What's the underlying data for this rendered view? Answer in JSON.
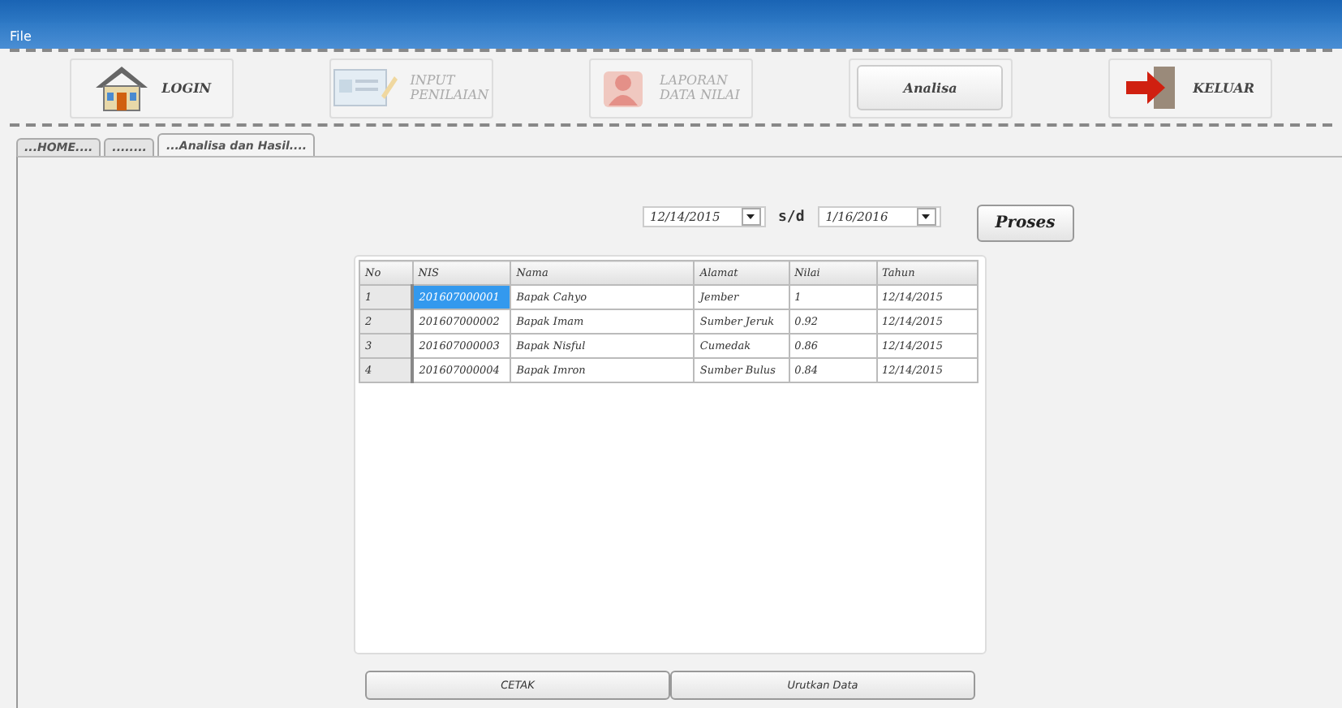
{
  "menu": [
    "File"
  ],
  "toolbar": [
    {
      "label": "LOGIN",
      "kind": "house",
      "disabled": false
    },
    {
      "label": "INPUT PENILAIAN",
      "kind": "form",
      "disabled": true
    },
    {
      "label": "LAPORAN DATA NILAI",
      "kind": "report",
      "disabled": true
    },
    {
      "label": "Analisa",
      "kind": "plain",
      "disabled": false
    },
    {
      "label": "KELUAR",
      "kind": "exit",
      "disabled": false
    }
  ],
  "tabs": [
    {
      "label": "...HOME....",
      "selected": false
    },
    {
      "label": "........",
      "selected": false
    },
    {
      "label": "...Analisa dan Hasil....",
      "selected": true
    }
  ],
  "filter": {
    "date_from": "12/14/2015",
    "separator": "s/d",
    "date_to": "1/16/2016",
    "button": "Proses"
  },
  "table": {
    "columns": [
      "No",
      "NIS",
      "Nama",
      "Alamat",
      "Nilai",
      "Tahun"
    ],
    "rows": [
      {
        "cells": [
          "1",
          "201607000001",
          "Bapak Cahyo",
          "Jember",
          "1",
          "12/14/2015"
        ],
        "selected": true
      },
      {
        "cells": [
          "2",
          "201607000002",
          "Bapak Imam",
          "Sumber Jeruk",
          "0.92",
          "12/14/2015"
        ],
        "selected": false
      },
      {
        "cells": [
          "3",
          "201607000003",
          "Bapak Nisful",
          "Cumedak",
          "0.86",
          "12/14/2015"
        ],
        "selected": false
      },
      {
        "cells": [
          "4",
          "201607000004",
          "Bapak Imron",
          "Sumber Bulus",
          "0.84",
          "12/14/2015"
        ],
        "selected": false
      }
    ]
  },
  "buttons": [
    "CETAK",
    "Urutkan Data"
  ]
}
